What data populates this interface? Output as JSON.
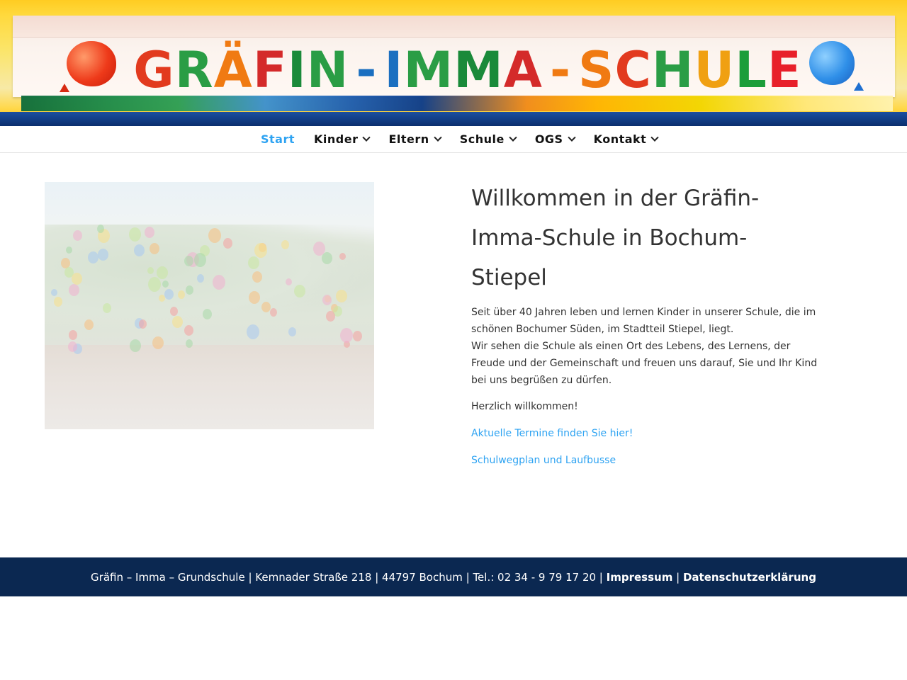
{
  "header": {
    "logo_letters": [
      {
        "ch": "G",
        "color": "#e23a1e"
      },
      {
        "ch": "R",
        "color": "#2a9d45"
      },
      {
        "ch": "Ä",
        "color": "#f07a12"
      },
      {
        "ch": "F",
        "color": "#d42a2a"
      },
      {
        "ch": "I",
        "color": "#1a8a3a"
      },
      {
        "ch": "N",
        "color": "#2a9d45"
      },
      {
        "ch": "-",
        "color": "#1b6fc0"
      },
      {
        "ch": "I",
        "color": "#1b6fc0"
      },
      {
        "ch": "M",
        "color": "#2a9d45"
      },
      {
        "ch": "M",
        "color": "#1a8a3a"
      },
      {
        "ch": "A",
        "color": "#d42a2a"
      },
      {
        "ch": "-",
        "color": "#f07a12"
      },
      {
        "ch": "S",
        "color": "#f07a12"
      },
      {
        "ch": "C",
        "color": "#e23a1e"
      },
      {
        "ch": "H",
        "color": "#2a9d45"
      },
      {
        "ch": "U",
        "color": "#f0a012"
      },
      {
        "ch": "L",
        "color": "#1b9d3a"
      },
      {
        "ch": "E",
        "color": "#e8202a"
      }
    ]
  },
  "nav": {
    "items": [
      {
        "label": "Start",
        "active": true,
        "has_dropdown": false
      },
      {
        "label": "Kinder",
        "active": false,
        "has_dropdown": true
      },
      {
        "label": "Eltern",
        "active": false,
        "has_dropdown": true
      },
      {
        "label": "Schule",
        "active": false,
        "has_dropdown": true
      },
      {
        "label": "OGS",
        "active": false,
        "has_dropdown": true
      },
      {
        "label": "Kontakt",
        "active": false,
        "has_dropdown": true
      }
    ],
    "active_color": "#2ea3f2"
  },
  "main": {
    "headline": "Willkommen in der Gräfin-Imma-Schule in Bochum-Stiepel",
    "intro_line1": "Seit über 40 Jahren leben und lernen Kinder in unserer Schule, die im schönen Bochumer Süden, im Stadtteil Stiepel, liegt.",
    "intro_line2": "Wir sehen die Schule als einen Ort des Lebens, des Lernens, der Freude und der Gemeinschaft und freuen uns darauf, Sie und Ihr Kind bei uns begrüßen zu dürfen.",
    "greeting": "Herzlich willkommen!",
    "link_termine": "Aktuelle Termine finden Sie hier!",
    "link_schulweg": "Schulwegplan und Laufbusse",
    "link_color": "#2ea3f2"
  },
  "footer": {
    "info": "Gräfin – Imma – Grundschule | Kemnader Straße 218 | 44797 Bochum | Tel.: 02 34 - 9 79 17 20 |",
    "impressum": "Impressum",
    "separator": "|",
    "datenschutz": "Datenschutzerklärung",
    "background": "#0b2851"
  }
}
